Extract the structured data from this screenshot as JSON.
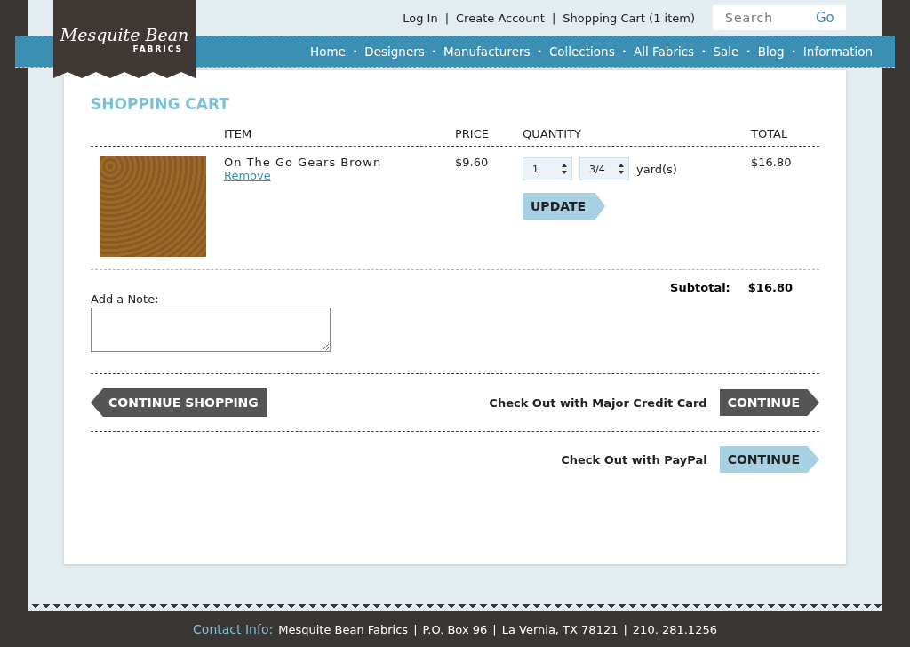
{
  "logo": {
    "name": "Mesquite Bean",
    "sub": "FABRICS"
  },
  "top_links": [
    "Log In",
    "Create Account",
    "Shopping Cart (1 item)"
  ],
  "top_separator": "|",
  "search": {
    "placeholder": "Search",
    "button": "Go"
  },
  "nav": [
    "Home",
    "Designers",
    "Manufacturers",
    "Collections",
    "All Fabrics",
    "Sale",
    "Blog",
    "Information"
  ],
  "nav_separator": "•",
  "title": "SHOPPING CART",
  "table": {
    "columns": [
      "ITEM",
      "PRICE",
      "QUANTITY",
      "TOTAL"
    ],
    "rows": [
      {
        "name": "On The Go Gears Brown",
        "remove": "Remove",
        "price": "$9.60",
        "quantity": "1",
        "fraction": "3/4",
        "unit": "yard(s)",
        "total": "$16.80"
      }
    ]
  },
  "update_button": "UPDATE",
  "subtotal": {
    "label": "Subtotal:",
    "value": "$16.80"
  },
  "note": {
    "label": "Add a Note:"
  },
  "continue_shopping": "CONTINUE SHOPPING",
  "checkouts": [
    {
      "label": "Check Out with Major Credit Card",
      "button": "CONTINUE",
      "kind": "dark"
    },
    {
      "label": "Check Out with PayPal",
      "button": "CONTINUE",
      "kind": "light"
    }
  ],
  "footer": {
    "label": "Contact Info:",
    "items": [
      "Mesquite Bean Fabrics",
      "P.O. Box 96",
      "La Vernia, TX 78121",
      "210. 281.1256"
    ],
    "separator": "|"
  }
}
